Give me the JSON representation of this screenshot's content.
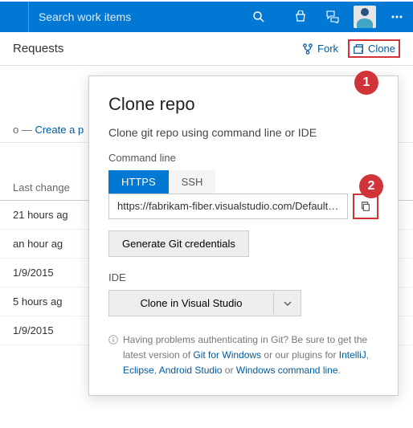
{
  "topbar": {
    "search_placeholder": "Search work items"
  },
  "subbar": {
    "title": "Requests",
    "fork_label": "Fork",
    "clone_label": "Clone"
  },
  "callouts": {
    "one": "1",
    "two": "2"
  },
  "breadcrumb": {
    "prefix": "o —",
    "link": "Create a p"
  },
  "list": {
    "header": "Last change",
    "rows": [
      "21 hours ag",
      "an hour ag",
      "1/9/2015",
      "5 hours ag",
      "1/9/2015"
    ]
  },
  "flyout": {
    "title": "Clone repo",
    "desc": "Clone git repo using command line or IDE",
    "cmdline_label": "Command line",
    "tab_https": "HTTPS",
    "tab_ssh": "SSH",
    "url": "https://fabrikam-fiber.visualstudio.com/DefaultColl...",
    "gen_creds": "Generate Git credentials",
    "ide_label": "IDE",
    "ide_btn": "Clone in Visual Studio",
    "help_pre": "Having problems authenticating in Git? Be sure to get the latest version of ",
    "help_git": "Git for Windows",
    "help_mid": " or our plugins for ",
    "help_intellij": "IntelliJ",
    "help_sep1": ", ",
    "help_eclipse": "Eclipse",
    "help_sep2": ", ",
    "help_android": "Android Studio",
    "help_or": " or ",
    "help_cmd": "Windows command line",
    "help_end": "."
  }
}
